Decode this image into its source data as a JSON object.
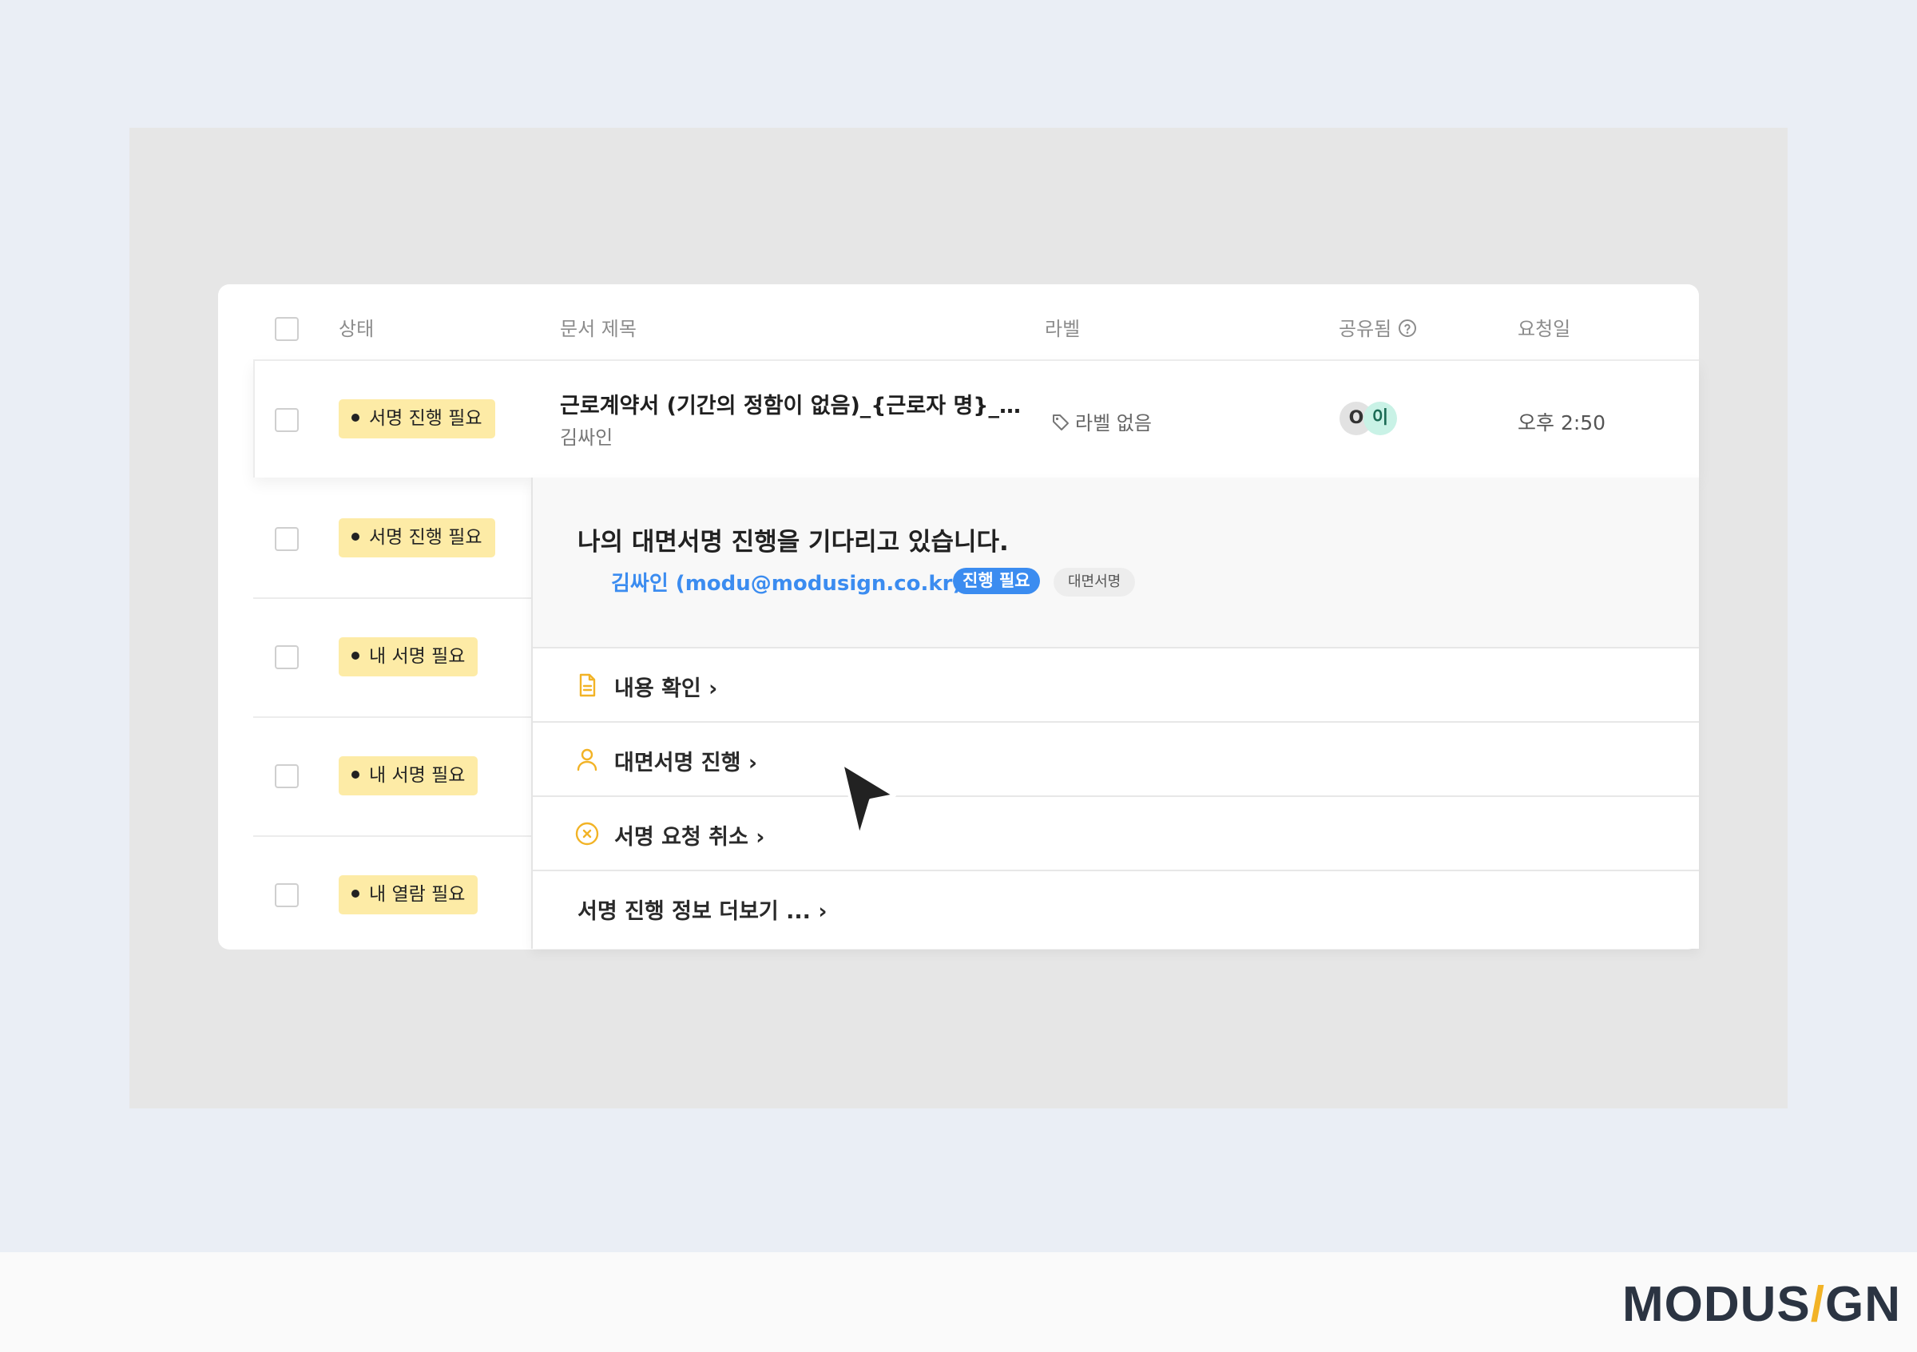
{
  "table": {
    "headers": {
      "status": "상태",
      "title": "문서 제목",
      "label": "라벨",
      "shared": "공유됨",
      "date": "요청일"
    },
    "rows": [
      {
        "status": "서명 진행 필요",
        "title": "근로계약서 (기간의 정함이 없음)_{근로자 명}_…",
        "sender": "김싸인",
        "label": "라벨 없음",
        "shared_avatars": [
          "O",
          "이"
        ],
        "date": "오후 2:50"
      },
      {
        "status": "서명 진행 필요"
      },
      {
        "status": "내 서명 필요"
      },
      {
        "status": "내 서명 필요"
      },
      {
        "status": "내 열람 필요"
      }
    ]
  },
  "panel": {
    "message": "나의 대면서명 진행을 기다리고 있습니다.",
    "signer": "김싸인 (modu@modusign.co.kr)",
    "signer_status": "진행 필요",
    "sign_type": "대면서명",
    "menu": [
      {
        "label": "내용 확인 ›",
        "icon": "document-icon"
      },
      {
        "label": "대면서명 진행 ›",
        "icon": "person-icon"
      },
      {
        "label": "서명 요청 취소 ›",
        "icon": "cancel-circle-icon"
      },
      {
        "label": "서명 진행 정보 더보기 ... ›"
      }
    ]
  },
  "brand": {
    "logo_left": "MODUS",
    "logo_slash": "/",
    "logo_right": "GN",
    "accent_color": "#f2b326",
    "link_color": "#3b8cf0",
    "badge_color": "#fdeba6"
  }
}
